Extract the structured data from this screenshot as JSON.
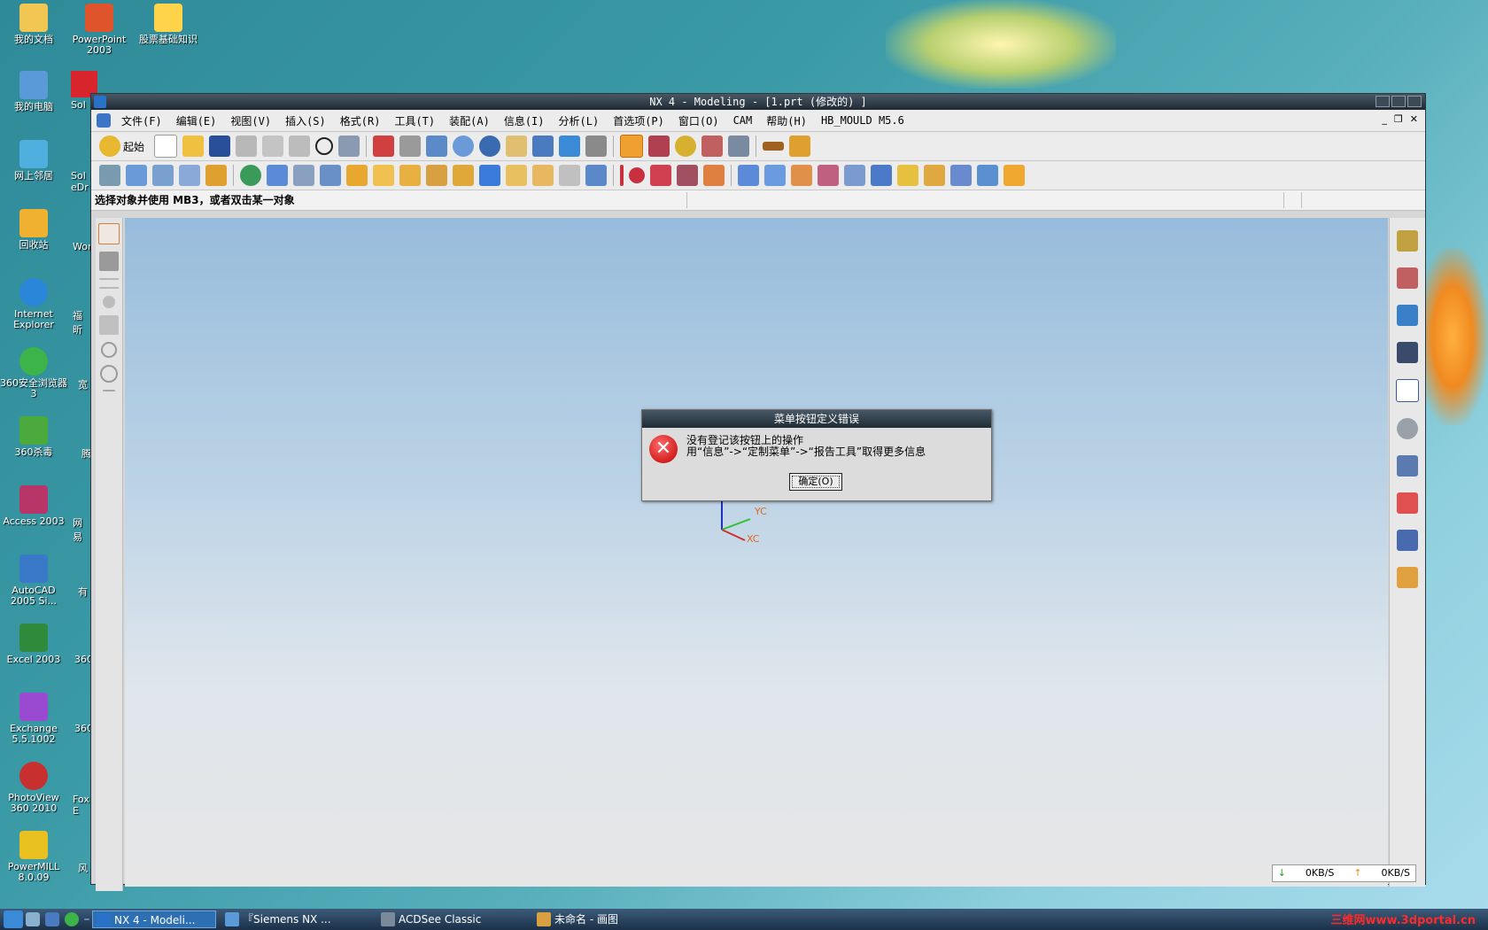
{
  "desktop": {
    "icons": [
      {
        "label": "我的文档",
        "icon": "documents-folder-icon",
        "color": "#f1c653"
      },
      {
        "label": "PowerPoint 2003",
        "icon": "powerpoint-icon",
        "color": "#e0542c"
      },
      {
        "label": "股票基础知识",
        "icon": "help-shortcut-icon",
        "color": "#ffd34a"
      },
      {
        "label": "我的电脑",
        "icon": "computer-icon",
        "color": "#5a9ad8"
      },
      {
        "label": "Sol",
        "icon": "solidworks-icon",
        "color": "#d8252d"
      },
      {
        "label": "网上邻居",
        "icon": "network-icon",
        "color": "#4fb0e0"
      },
      {
        "label": "Sol eDr",
        "icon": "edrawings-icon",
        "color": "#7a9ab0"
      },
      {
        "label": "回收站",
        "icon": "recycle-bin-icon",
        "color": "#f0b030"
      },
      {
        "label": "Wor",
        "icon": "word-icon",
        "color": "#3a6cc0"
      },
      {
        "label": "Internet Explorer",
        "icon": "ie-icon",
        "color": "#2a86d8"
      },
      {
        "label": "福昕",
        "icon": "foxit-icon",
        "color": "#d84040"
      },
      {
        "label": "360安全浏览器 3",
        "icon": "browser360-icon",
        "color": "#3cb44a"
      },
      {
        "label": "宽",
        "icon": "broadband-icon",
        "color": "#3a88c8"
      },
      {
        "label": "360杀毒",
        "icon": "antivirus360-icon",
        "color": "#4caa3c"
      },
      {
        "label": "腾",
        "icon": "tencent-icon",
        "color": "#4a8ad0"
      },
      {
        "label": "Access 2003",
        "icon": "access-icon",
        "color": "#b8356a"
      },
      {
        "label": "网易",
        "icon": "netease-icon",
        "color": "#d83a3a"
      },
      {
        "label": "AutoCAD 2005 Si...",
        "icon": "autocad-icon",
        "color": "#3a78c8"
      },
      {
        "label": "有",
        "icon": "generic-icon",
        "color": "#8ab0d0"
      },
      {
        "label": "Excel 2003",
        "icon": "excel-icon",
        "color": "#2f8a3c"
      },
      {
        "label": "360",
        "icon": "app360-icon",
        "color": "#48a048"
      },
      {
        "label": "Exchange 5.5.1002",
        "icon": "exchange-icon",
        "color": "#9a4ad0"
      },
      {
        "label": "360",
        "icon": "app360b-icon",
        "color": "#48a048"
      },
      {
        "label": "PhotoView 360 2010",
        "icon": "photoview-icon",
        "color": "#c83030"
      },
      {
        "label": "Fox E",
        "icon": "foxmail-icon",
        "color": "#d86a20"
      },
      {
        "label": "PowerMILL 8.0.09",
        "icon": "powermill-icon",
        "color": "#e8c020"
      },
      {
        "label": "风",
        "icon": "wind-icon",
        "color": "#c84040"
      }
    ]
  },
  "window": {
    "title": "NX 4 - Modeling - [1.prt  (修改的) ]",
    "menu": [
      "文件(F)",
      "编辑(E)",
      "视图(V)",
      "插入(S)",
      "格式(R)",
      "工具(T)",
      "装配(A)",
      "信息(I)",
      "分析(L)",
      "首选项(P)",
      "窗口(O)",
      "CAM",
      "帮助(H)",
      "HB_MOULD M5.6"
    ],
    "start_label": "起始",
    "status_prompt": "选择对象并使用 MB3，或者双击某一对象",
    "triad_x": "XC",
    "triad_y": "YC",
    "net_down": "0KB/S",
    "net_up": "0KB/S"
  },
  "dialog": {
    "title": "菜单按钮定义错误",
    "line1": "没有登记该按钮上的操作",
    "line2": "用“信息”->“定制菜单”->“报告工具”取得更多信息",
    "ok_label": "确定(O)"
  },
  "taskbar": {
    "tasks": [
      {
        "label": "NX 4 - Modeli...",
        "active": true
      },
      {
        "label": "『Siemens NX ...",
        "active": false
      },
      {
        "label": "ACDSee Classic",
        "active": false
      },
      {
        "label": "未命名 - 画图",
        "active": false
      }
    ],
    "watermark": "三维网www.3dportal.cn"
  },
  "colors": {
    "accent": "#2c6fb3",
    "error": "#c00000"
  }
}
